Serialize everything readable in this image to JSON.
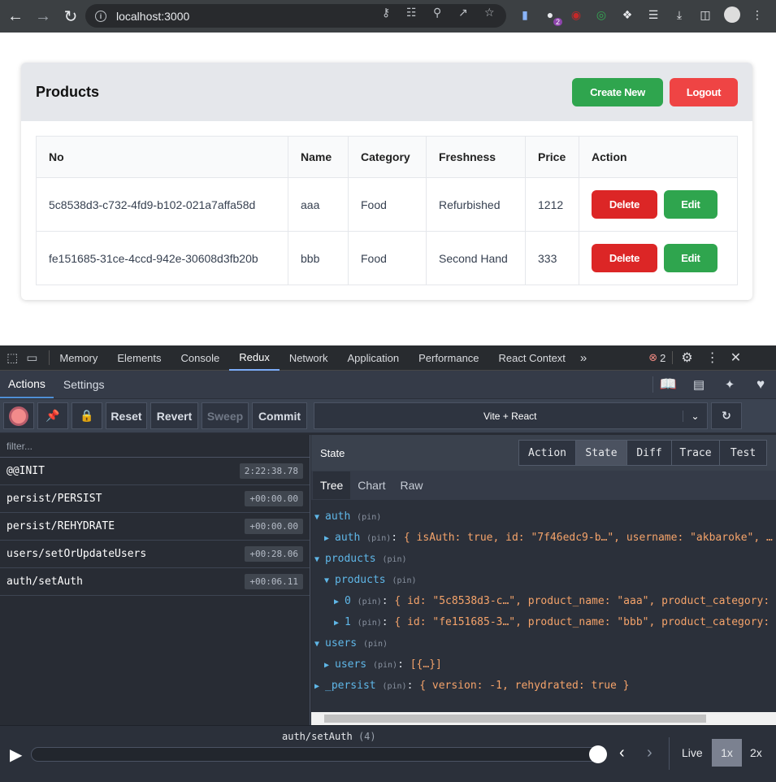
{
  "browser": {
    "url": "localhost:3000",
    "extension_badge": "2"
  },
  "app": {
    "title": "Products",
    "create_label": "Create New",
    "logout_label": "Logout",
    "columns": [
      "No",
      "Name",
      "Category",
      "Freshness",
      "Price",
      "Action"
    ],
    "rows": [
      {
        "no": "5c8538d3-c732-4fd9-b102-021a7affa58d",
        "name": "aaa",
        "category": "Food",
        "freshness": "Refurbished",
        "price": "1212"
      },
      {
        "no": "fe151685-31ce-4ccd-942e-30608d3fb20b",
        "name": "bbb",
        "category": "Food",
        "freshness": "Second Hand",
        "price": "333"
      }
    ],
    "delete_label": "Delete",
    "edit_label": "Edit"
  },
  "devtools": {
    "tabs": [
      "Memory",
      "Elements",
      "Console",
      "Redux",
      "Network",
      "Application",
      "Performance",
      "React Context"
    ],
    "active_tab": "Redux",
    "error_count": "2"
  },
  "redux": {
    "top_tabs": [
      "Actions",
      "Settings"
    ],
    "toolbar": {
      "reset": "Reset",
      "revert": "Revert",
      "sweep": "Sweep",
      "commit": "Commit",
      "instance": "Vite + React"
    },
    "filter_placeholder": "filter...",
    "actions": [
      {
        "name": "@@INIT",
        "time": "2:22:38.78"
      },
      {
        "name": "persist/PERSIST",
        "time": "+00:00.00"
      },
      {
        "name": "persist/REHYDRATE",
        "time": "+00:00.00"
      },
      {
        "name": "users/setOrUpdateUsers",
        "time": "+00:28.06"
      },
      {
        "name": "auth/setAuth",
        "time": "+00:06.11"
      }
    ],
    "panel_title": "State",
    "monitor_tabs": [
      "Action",
      "State",
      "Diff",
      "Trace",
      "Test"
    ],
    "view_tabs": [
      "Tree",
      "Chart",
      "Raw"
    ],
    "pin": "(pin)",
    "tree": {
      "auth": "auth",
      "auth_inner_key": "auth",
      "auth_inner_val": "{ isAuth: true, id: \"7f46edc9-b…\", username: \"akbaroke\", …",
      "products": "products",
      "products_inner": "products",
      "p0_key": "0",
      "p0_val": "{ id: \"5c8538d3-c…\", product_name: \"aaa\", product_category: \"",
      "p1_key": "1",
      "p1_val": "{ id: \"fe151685-3…\", product_name: \"bbb\", product_category: \"",
      "users": "users",
      "users_inner": "users",
      "users_val": "[{…}]",
      "persist": "_persist",
      "persist_val": "{ version: -1, rehydrated: true }"
    },
    "slider": {
      "label": "auth/setAuth",
      "count": "(4)",
      "live": "Live",
      "speed1": "1x",
      "speed2": "2x"
    }
  }
}
